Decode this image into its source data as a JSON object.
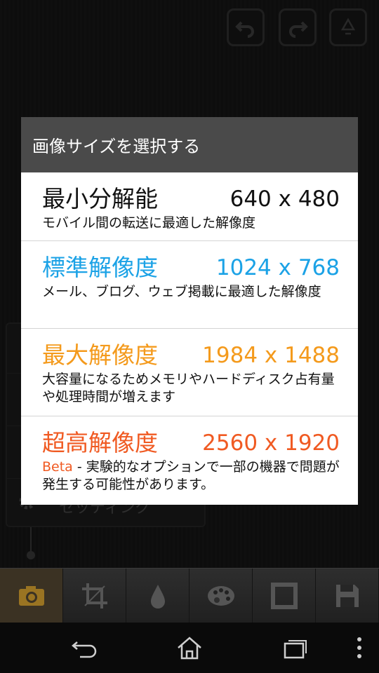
{
  "dialog": {
    "title": "画像サイズを選択する",
    "options": [
      {
        "label": "最小分解能",
        "resolution": "640 x 480",
        "description": "モバイル間の転送に最適した解像度",
        "color": "#111111"
      },
      {
        "label": "標準解像度",
        "resolution": "1024 x 768",
        "description": "メール、ブログ、ウェブ掲載に最適した解像度",
        "color": "#1ba2e6"
      },
      {
        "label": "最大解像度",
        "resolution": "1984 x 1488",
        "description": "大容量になるためメモリやハードディスク占有量や処理時間が増えます",
        "color": "#f49a1c"
      },
      {
        "label": "超高解像度",
        "resolution": "2560 x 1920",
        "beta_tag": "Beta",
        "description": " - 実験的なオプションで一部の機器で問題が発生する可能性があります。",
        "color": "#f05a22"
      }
    ]
  },
  "top_toolbar": {
    "icons": [
      "undo-icon",
      "redo-icon",
      "recycle-icon"
    ]
  },
  "bottom_toolbar": {
    "tools": [
      "camera-icon",
      "crop-icon",
      "drop-icon",
      "palette-icon",
      "frame-icon",
      "save-icon"
    ],
    "active": "camera-icon"
  },
  "background_menu": {
    "visible_label": "セッティング"
  },
  "navbar": {
    "icons": [
      "back-icon",
      "home-icon",
      "recent-apps-icon",
      "menu-icon"
    ]
  }
}
